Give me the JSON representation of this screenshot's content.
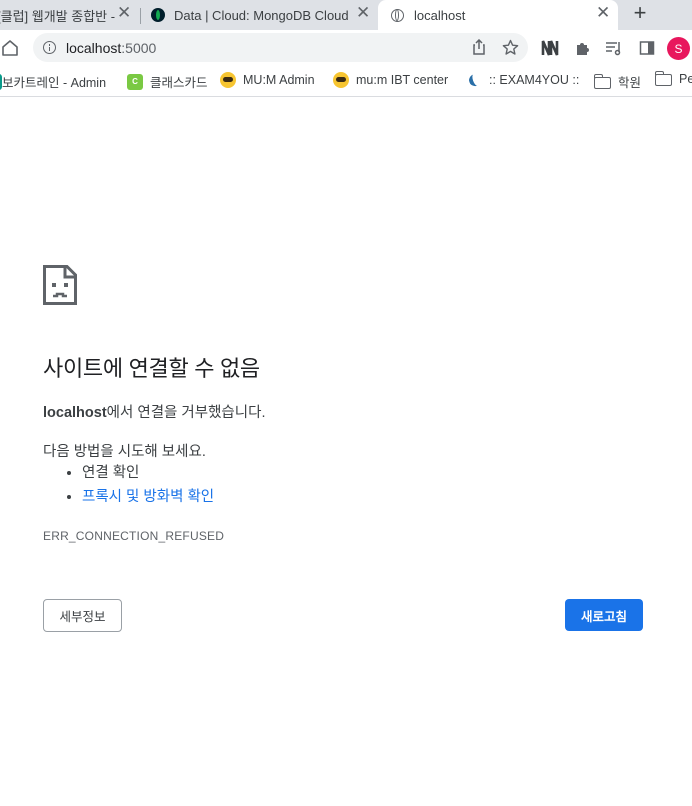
{
  "tabs": [
    {
      "title": "[클럽] 웹개발 종합반 -",
      "active": false
    },
    {
      "title": "Data | Cloud: MongoDB Cloud",
      "active": false
    },
    {
      "title": "localhost",
      "active": true
    }
  ],
  "toolbar": {
    "url_host": "localhost",
    "url_port": ":5000",
    "profile_initial": "S",
    "icons": [
      "home-icon",
      "site-info-icon",
      "share-icon",
      "bookmark-star-icon",
      "extension-n-icon",
      "puzzle-icon",
      "reading-list-icon",
      "side-panel-icon"
    ]
  },
  "bookmarks": [
    {
      "label": "보카트레인 - Admin",
      "icon": "vocatrain-icon"
    },
    {
      "label": "클래스카드",
      "icon": "classcard-icon"
    },
    {
      "label": "MU:M Admin",
      "icon": "mum-icon"
    },
    {
      "label": "mu:m IBT center",
      "icon": "mum-icon"
    },
    {
      "label": ":: EXAM4YOU ::",
      "icon": "exam4you-icon"
    },
    {
      "label": "학원",
      "icon": "folder-icon"
    },
    {
      "label": "Pe",
      "icon": "folder-icon"
    }
  ],
  "error": {
    "title": "사이트에 연결할 수 없음",
    "desc_host": "localhost",
    "desc_rest": "에서 연결을 거부했습니다.",
    "try_text": "다음 방법을 시도해 보세요.",
    "suggestions": [
      "연결 확인",
      "프록시 및 방화벽 확인"
    ],
    "code": "ERR_CONNECTION_REFUSED",
    "details_button": "세부정보",
    "reload_button": "새로고침"
  },
  "colors": {
    "accent": "#1a73e8",
    "avatar": "#e8175d",
    "tabstrip": "#dee1e6"
  }
}
